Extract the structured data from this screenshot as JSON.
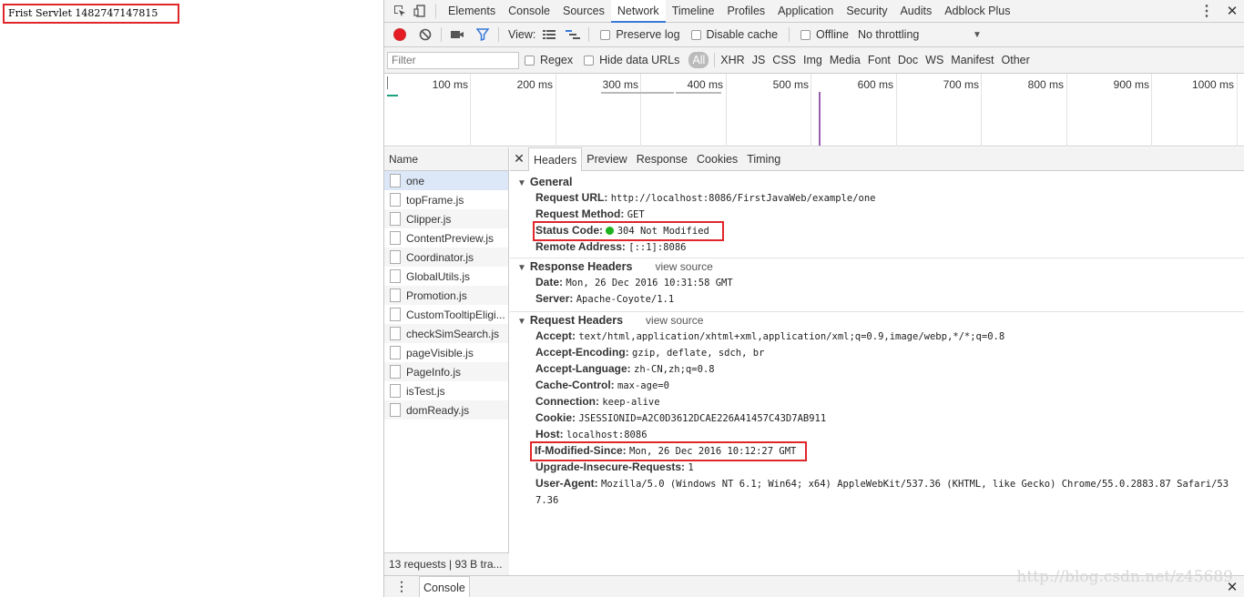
{
  "page": {
    "text": "Frist Servlet 1482747147815"
  },
  "devtools": {
    "tabs": [
      "Elements",
      "Console",
      "Sources",
      "Network",
      "Timeline",
      "Profiles",
      "Application",
      "Security",
      "Audits",
      "Adblock Plus"
    ],
    "active_tab": "Network",
    "toolbar": {
      "view_label": "View:",
      "preserve_log": "Preserve log",
      "disable_cache": "Disable cache",
      "offline": "Offline",
      "throttling": "No throttling"
    },
    "filter": {
      "placeholder": "Filter",
      "regex": "Regex",
      "hide_data_urls": "Hide data URLs",
      "types": [
        "All",
        "XHR",
        "JS",
        "CSS",
        "Img",
        "Media",
        "Font",
        "Doc",
        "WS",
        "Manifest",
        "Other"
      ]
    },
    "timeline_ticks": [
      "100 ms",
      "200 ms",
      "300 ms",
      "400 ms",
      "500 ms",
      "600 ms",
      "700 ms",
      "800 ms",
      "900 ms",
      "1000 ms"
    ],
    "requests": {
      "header": "Name",
      "items": [
        "one",
        "topFrame.js",
        "Clipper.js",
        "ContentPreview.js",
        "Coordinator.js",
        "GlobalUtils.js",
        "Promotion.js",
        "CustomTooltipEligi...",
        "checkSimSearch.js",
        "pageVisible.js",
        "PageInfo.js",
        "isTest.js",
        "domReady.js"
      ],
      "status": "13 requests | 93 B tra..."
    },
    "detail_tabs": [
      "Headers",
      "Preview",
      "Response",
      "Cookies",
      "Timing"
    ],
    "general": {
      "title": "General",
      "request_url_k": "Request URL:",
      "request_url_v": "http://localhost:8086/FirstJavaWeb/example/one",
      "method_k": "Request Method:",
      "method_v": "GET",
      "status_k": "Status Code:",
      "status_v": "304 Not Modified",
      "remote_k": "Remote Address:",
      "remote_v": "[::1]:8086"
    },
    "response_headers": {
      "title": "Response Headers",
      "view_source": "view source",
      "date_k": "Date:",
      "date_v": "Mon, 26 Dec 2016 10:31:58 GMT",
      "server_k": "Server:",
      "server_v": "Apache-Coyote/1.1"
    },
    "request_headers": {
      "title": "Request Headers",
      "view_source": "view source",
      "accept_k": "Accept:",
      "accept_v": "text/html,application/xhtml+xml,application/xml;q=0.9,image/webp,*/*;q=0.8",
      "encoding_k": "Accept-Encoding:",
      "encoding_v": "gzip, deflate, sdch, br",
      "language_k": "Accept-Language:",
      "language_v": "zh-CN,zh;q=0.8",
      "cache_k": "Cache-Control:",
      "cache_v": "max-age=0",
      "conn_k": "Connection:",
      "conn_v": "keep-alive",
      "cookie_k": "Cookie:",
      "cookie_v": "JSESSIONID=A2C0D3612DCAE226A41457C43D7AB911",
      "host_k": "Host:",
      "host_v": "localhost:8086",
      "ims_k": "If-Modified-Since:",
      "ims_v": "Mon, 26 Dec 2016 10:12:27 GMT",
      "upgrade_k": "Upgrade-Insecure-Requests:",
      "upgrade_v": "1",
      "ua_k": "User-Agent:",
      "ua_v": "Mozilla/5.0 (Windows NT 6.1; Win64; x64) AppleWebKit/537.36 (KHTML, like Gecko) Chrome/55.0.2883.87 Safari/537.36"
    },
    "drawer": {
      "tab": "Console"
    },
    "watermark": "http://blog.csdn.net/z45689"
  }
}
